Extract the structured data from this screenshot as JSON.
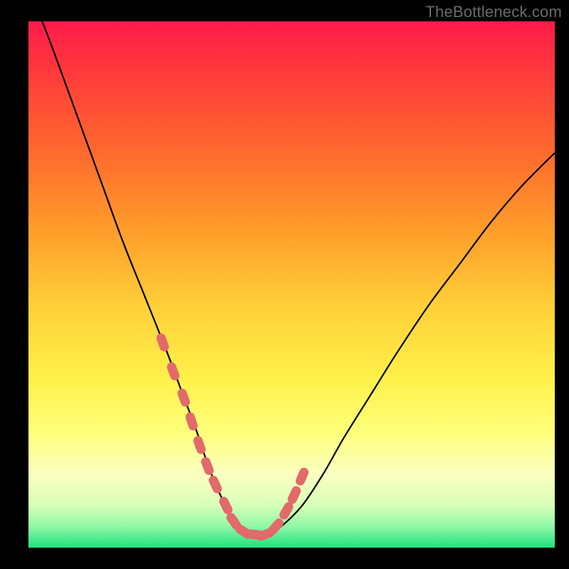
{
  "watermark": "TheBottleneck.com",
  "chart_data": {
    "type": "line",
    "title": "",
    "xlabel": "",
    "ylabel": "",
    "xlim": [
      0,
      100
    ],
    "ylim": [
      0,
      100
    ],
    "series": [
      {
        "name": "bottleneck-curve",
        "x": [
          0,
          3,
          6,
          10,
          14,
          18,
          22,
          26,
          29,
          32,
          34,
          36,
          38,
          40,
          42,
          45,
          48,
          52,
          56,
          60,
          65,
          70,
          76,
          82,
          88,
          94,
          100
        ],
        "values": [
          106,
          99,
          91,
          80,
          69,
          58,
          48,
          38,
          30,
          22,
          16,
          11,
          7,
          4,
          2,
          2,
          4,
          8,
          14,
          21,
          29,
          37,
          46,
          54,
          62,
          69,
          75
        ]
      }
    ],
    "markers": {
      "name": "highlighted-points",
      "x": [
        25.5,
        27.5,
        29.5,
        31.0,
        32.5,
        34.0,
        35.5,
        37.5,
        39.0,
        41.0,
        43.0,
        45.0,
        47.0,
        49.0,
        50.5,
        52.0
      ],
      "values": [
        39.0,
        33.5,
        28.5,
        24.0,
        19.5,
        15.5,
        12.0,
        8.0,
        5.0,
        3.0,
        2.5,
        2.5,
        4.0,
        7.0,
        10.0,
        13.5
      ],
      "color": "#e26a6a"
    },
    "colors": {
      "curve": "#000000",
      "marker": "#e26a6a",
      "background_top": "#ff1a4b",
      "background_bottom": "#1de27e",
      "frame": "#000000"
    }
  }
}
